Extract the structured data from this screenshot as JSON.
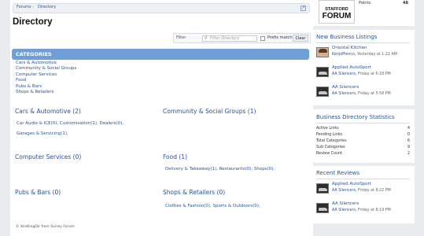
{
  "breadcrumb": {
    "forums": "Forums",
    "sep": "›",
    "directory": "Directory",
    "icon": "external-link-icon"
  },
  "page_title": "Directory",
  "filter": {
    "label": "Filter",
    "placeholder": "Filter Directory",
    "prefix_match_label": "Prefix match",
    "clear_label": "Clear",
    "search_icon": "search-icon"
  },
  "categories": {
    "header": "CATEGORIES",
    "items": [
      "Cars & Automotive",
      "Community & Social Groups",
      "Computer Services",
      "Food",
      "Pubs & Bars",
      "Shops & Retailers"
    ]
  },
  "sections": {
    "cars": {
      "title": "Cars & Automotive (2)",
      "line1": "Car Audio & ICE(0), Customisation(1), Dealers(0),",
      "line2": "Garages & Servicing(1),"
    },
    "community": {
      "title": "Community & Social Groups (1)"
    },
    "computer": {
      "title": "Computer Services (0)"
    },
    "food": {
      "title": "Food (1)",
      "line1": "Delivery & Takeaway(1), Restaurants(0), Shops(0),"
    },
    "pubs": {
      "title": "Pubs & Bars (0)"
    },
    "shops": {
      "title": "Shops & Retailers (0)",
      "line1": "Clothes & Fashion(0), Sports & Outdoors(0),"
    }
  },
  "footer": "© XenKingDir from Surrey Forum",
  "sidebar": {
    "logo": {
      "top": "STAFFORD",
      "main": "FORUM"
    },
    "points_label": "Points:",
    "points_value": "48",
    "new_listings": {
      "title": "New Business Listings",
      "items": [
        {
          "title": "Oriental Kitchen",
          "user": "KenjoPlenco,",
          "time": "Yesterday at 1:22 AM"
        },
        {
          "title": "Applied AutoSport",
          "user": "AA Silencers,",
          "time": "Friday at 6:18 PM"
        },
        {
          "title": "AA Silencers",
          "user": "AA Silencers,",
          "time": "Friday at 5:58 PM"
        }
      ]
    },
    "stats": {
      "title": "Business Directory Statistics",
      "rows": [
        {
          "label": "Active Links",
          "value": "4"
        },
        {
          "label": "Pending Links",
          "value": "0"
        },
        {
          "label": "Total Categories",
          "value": "6"
        },
        {
          "label": "Sub Categories",
          "value": "9"
        },
        {
          "label": "Review Count",
          "value": "2"
        }
      ]
    },
    "reviews": {
      "title": "Recent Reviews",
      "items": [
        {
          "title": "Applied AutoSport",
          "user": "AA Silencers,",
          "time": "Friday at 8:22 PM"
        },
        {
          "title": "AA Silencers",
          "user": "AA Silencers,",
          "time": "Friday at 8:19 PM"
        }
      ]
    }
  }
}
